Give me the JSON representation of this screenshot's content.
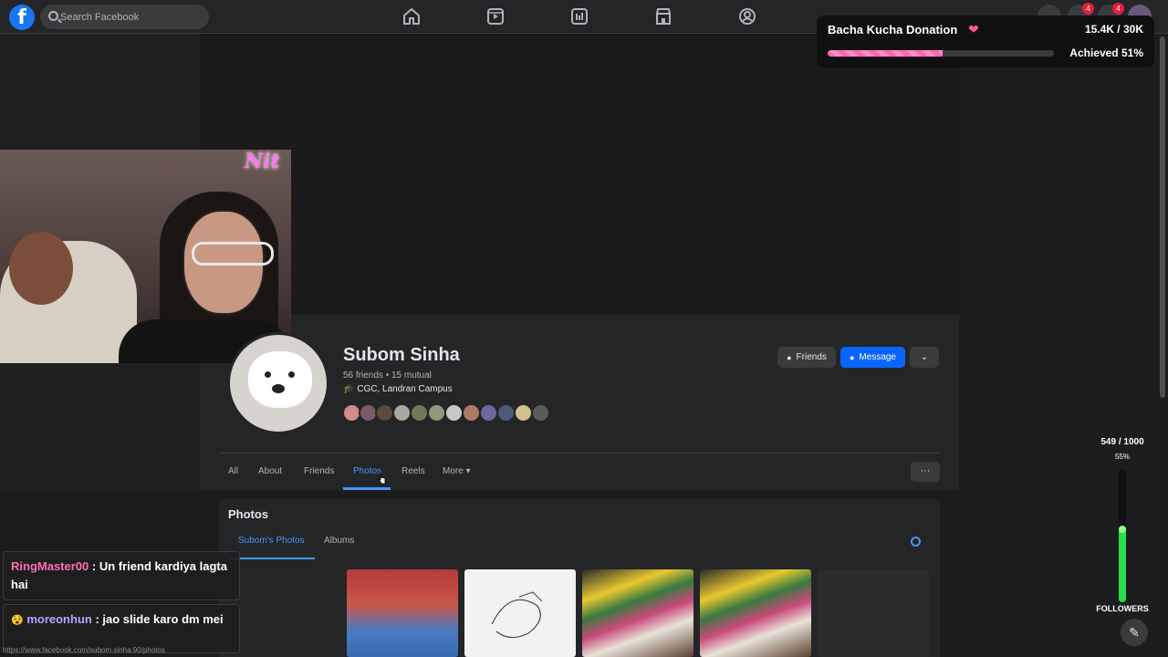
{
  "topbar": {
    "logo": "f",
    "search_placeholder": "Search Facebook",
    "nav_icons": [
      "home-icon",
      "video-icon",
      "news-icon",
      "marketplace-icon",
      "groups-icon"
    ],
    "notification_badges": [
      "4",
      "4"
    ]
  },
  "donation": {
    "title": "Bacha Kucha Donation",
    "heart": "❤",
    "amount": "15.4K / 30K",
    "achieved": "Achieved 51%",
    "progress_percent": 51
  },
  "profile": {
    "name": "Subom Sinha",
    "friends_summary": "56 friends • 15 mutual",
    "work_icon": "🎓",
    "work": "CGC, Landran Campus",
    "buttons": {
      "friends": "Friends",
      "message": "Message",
      "more": "⌄"
    }
  },
  "tabs": [
    "All",
    "About",
    "Friends",
    "Photos",
    "Reels",
    "More ▾"
  ],
  "tab_more_button": "···",
  "photos_section": {
    "title": "Photos",
    "subtabs": [
      "Subom's Photos",
      "Albums"
    ]
  },
  "chat": [
    {
      "user": "RingMaster00",
      "message": "Un friend kardiya lagta hai"
    },
    {
      "badge": "😵",
      "user": "moreonhun",
      "message": "jao slide karo dm mei"
    }
  ],
  "status_url": "https://www.facebook.com/subom.sinha.90/photos",
  "followers": {
    "count": "549 / 1000",
    "percent_label": "55%",
    "label": "FOLLOWERS",
    "progress_percent": 55
  },
  "overlay_text": "Nit",
  "colors": {
    "accent": "#4599ff",
    "brand": "#1877f2",
    "donation_bar": "#ff66b0",
    "followers_bar": "#27e04b"
  }
}
